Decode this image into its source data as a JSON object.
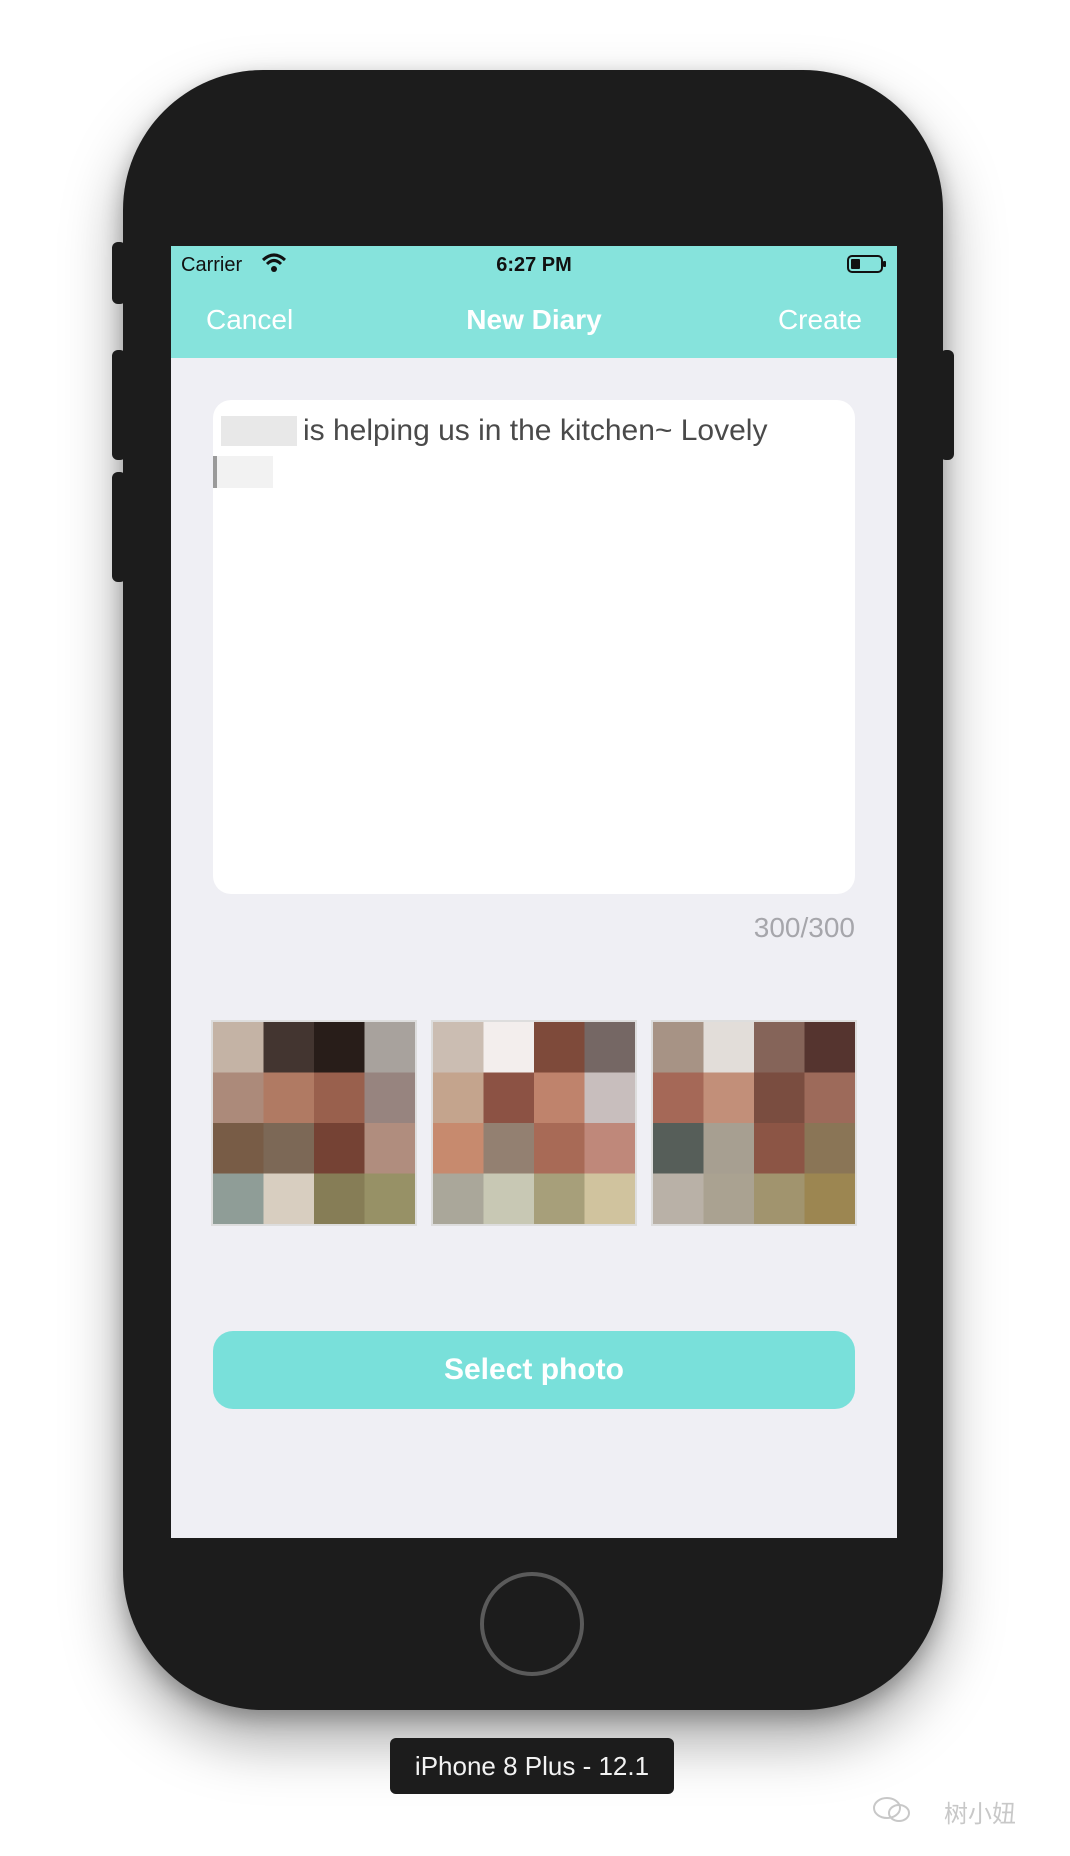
{
  "status_bar": {
    "carrier": "Carrier",
    "time": "6:27 PM"
  },
  "nav": {
    "cancel": "Cancel",
    "title": "New Diary",
    "create": "Create"
  },
  "diary": {
    "text": "is helping us in the kitchen~ Lovely",
    "counter": "300/300"
  },
  "photos": [
    {
      "label": "photo-1",
      "colors": [
        "#c4b3a5",
        "#433530",
        "#281d19",
        "#a8a29d",
        "#ac8a7a",
        "#b07a63",
        "#99604d",
        "#97847f",
        "#785c46",
        "#7c6856",
        "#754234",
        "#b08d7e",
        "#8f9d97",
        "#d8cec0",
        "#867d56",
        "#979166"
      ]
    },
    {
      "label": "photo-2",
      "colors": [
        "#cbbdb2",
        "#f3eeed",
        "#7e4a3a",
        "#756764",
        "#c4a48d",
        "#8c5244",
        "#bf836c",
        "#c8bebd",
        "#c78a6e",
        "#938071",
        "#a86a56",
        "#bf887a",
        "#aaa79a",
        "#c8c8b4",
        "#a79f7a",
        "#d0c39e"
      ]
    },
    {
      "label": "photo-3",
      "colors": [
        "#a79385",
        "#e2ddd9",
        "#856459",
        "#55342f",
        "#a56857",
        "#c28f79",
        "#7a4d40",
        "#9d6a5a",
        "#565e59",
        "#a79f91",
        "#8c5545",
        "#8a7556",
        "#b9b1a7",
        "#aaa291",
        "#a1946e",
        "#9c8651"
      ]
    }
  ],
  "select_button": {
    "label": "Select photo"
  },
  "device": {
    "label": "iPhone 8 Plus - 12.1"
  },
  "watermark": {
    "text": "树小妞"
  },
  "colors": {
    "header": "#86e3dc",
    "button": "#79e0da",
    "screen_bg": "#efeff4"
  }
}
